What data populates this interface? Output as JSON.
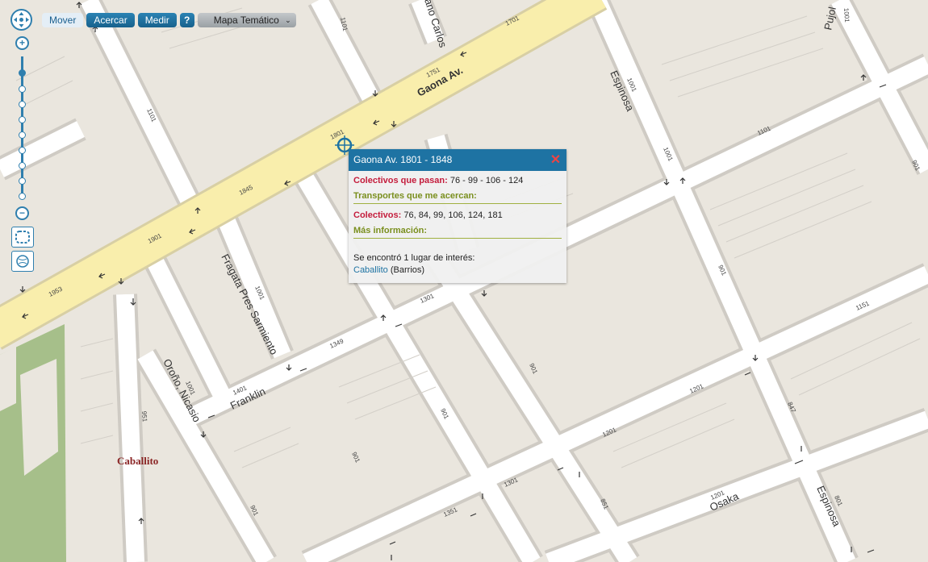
{
  "toolbar": {
    "move": "Mover",
    "zoom_in": "Acercar",
    "measure": "Medir",
    "help": "?",
    "theme_map": "Mapa Temático"
  },
  "popup": {
    "title": "Gaona Av. 1801 - 1848",
    "colectivos_label": "Colectivos que pasan:",
    "colectivos_value": "76 - 99 - 106 - 124",
    "transportes_header": "Transportes que me acercan:",
    "colectivos2_label": "Colectivos:",
    "colectivos2_value": "76, 84, 99, 106, 124, 181",
    "mas_info_header": "Más información:",
    "found_text": "Se encontró 1 lugar de interés:",
    "place_link": "Caballito",
    "place_type": "(Barrios)"
  },
  "map": {
    "streets": {
      "gaona": "Gaona Av.",
      "espinosa_top": "Espinosa",
      "espinosa_bottom": "Espinosa",
      "pujol": "Pujol",
      "carlos": "ano Carlos",
      "fragata": "Fragata Pres Sarmiento",
      "franklin": "Franklin",
      "orono": "Oroño, Nicasio",
      "osaka": "Osaka"
    },
    "neighborhood": "Caballito",
    "house_numbers": {
      "n1101a": "1101",
      "n1701": "1701",
      "n1751": "1751",
      "n1801": "1801",
      "n1845": "1845",
      "n1901": "1901",
      "n1953": "1953",
      "n1101b": "1101",
      "n1001a": "1001",
      "n1001b": "1001",
      "n1101c": "1101",
      "n901a": "901",
      "n1001c": "1001",
      "n1301a": "1301",
      "n1349": "1349",
      "n1401": "1401",
      "n1001d": "1001",
      "n951": "951",
      "n901b": "901",
      "n901c": "901",
      "n901d": "901",
      "n1151": "1151",
      "n1201a": "1201",
      "n1201b": "1201",
      "n1301b": "1301",
      "n1351": "1351",
      "n851": "851",
      "n1201c": "1201",
      "n847": "847",
      "n801": "801",
      "n901e": "901",
      "n901f": "901",
      "n1001e": "1001"
    }
  }
}
